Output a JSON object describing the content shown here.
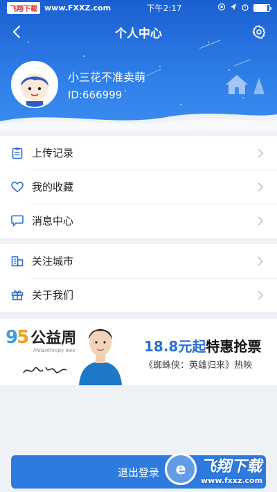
{
  "status_bar": {
    "watermark_badge": "飞翔下载",
    "watermark_url": "www.FXXZ.com",
    "time": "下午2:17"
  },
  "nav": {
    "title": "个人中心",
    "back_icon": "chevron-left-icon",
    "settings_icon": "gear-icon"
  },
  "profile": {
    "name": "小三花不准卖萌",
    "id_text": "ID:666999"
  },
  "menu_group_1": [
    {
      "label": "上传记录",
      "icon": "clipboard-icon"
    },
    {
      "label": "我的收藏",
      "icon": "heart-icon"
    },
    {
      "label": "消息中心",
      "icon": "message-icon"
    }
  ],
  "menu_group_2": [
    {
      "label": "关注城市",
      "icon": "city-icon"
    },
    {
      "label": "关于我们",
      "icon": "gift-icon"
    }
  ],
  "banner": {
    "logo_number_left": "9",
    "logo_number_right": "5",
    "logo_text": "公益周",
    "logo_sub": "Philanthropy week",
    "price": "18.8元起",
    "price_tail": "特惠抢票",
    "subtitle": "《蜘蛛侠：英雄归来》热映"
  },
  "logout": {
    "label": "退出登录"
  },
  "watermark_bottom": {
    "title": "飞翔下载",
    "url": "www.fxxz.com"
  },
  "colors": {
    "header_top": "#1a5fd0",
    "header_bottom": "#3b8cf0",
    "accent": "#2e7be0",
    "icon": "#2a6fd6"
  }
}
